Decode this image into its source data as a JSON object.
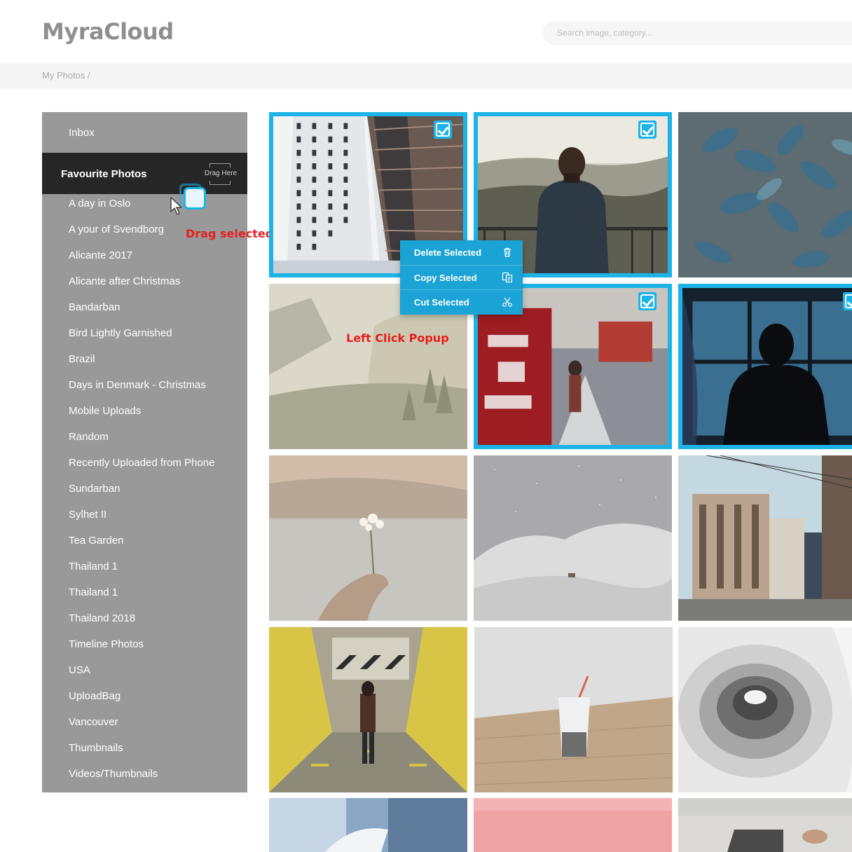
{
  "app": {
    "logo": "MyraCloud"
  },
  "search": {
    "placeholder": "Search image, category..."
  },
  "breadcrumb": "My Photos /",
  "sidebar": {
    "inbox": "Inbox",
    "active": "Favourite Photos",
    "drop_zone": "Drag Here",
    "albums": [
      "A day in Oslo",
      "A your of Svendborg",
      "Alicante 2017",
      "Alicante after Christmas",
      "Bandarban",
      "Bird Lightly Garnished",
      "Brazil",
      "Days in Denmark - Christmas",
      "Mobile Uploads",
      "Random",
      "Recently Uploaded from Phone",
      "Sundarban",
      "Sylhet II",
      "Tea Garden",
      "Thailand 1",
      "Thailand 1",
      "Thailand 2018",
      "Timeline Photos",
      "USA",
      "UploadBag",
      "Vancouver",
      "Thumbnails",
      "Videos/Thumbnails"
    ]
  },
  "annotations": {
    "drag": "Drag selected Image",
    "popup": "Left Click Popup"
  },
  "context_menu": [
    {
      "label": "Delete Selected",
      "icon": "trash-icon"
    },
    {
      "label": "Copy Selected",
      "icon": "copy-icon"
    },
    {
      "label": "Cut Selected",
      "icon": "scissors-icon"
    }
  ],
  "photos": [
    {
      "subject": "skyscrapers",
      "selected": true
    },
    {
      "subject": "man-overlooking-hills",
      "selected": true
    },
    {
      "subject": "blue-leaves",
      "selected": false
    },
    {
      "subject": "misty-valley",
      "selected": false
    },
    {
      "subject": "city-street-red-box",
      "selected": true
    },
    {
      "subject": "man-at-window",
      "selected": true
    },
    {
      "subject": "hand-holding-flower",
      "selected": false
    },
    {
      "subject": "snowy-mountain-night",
      "selected": false
    },
    {
      "subject": "city-buildings",
      "selected": false
    },
    {
      "subject": "yellow-alley-person",
      "selected": false
    },
    {
      "subject": "drink-on-table",
      "selected": false
    },
    {
      "subject": "spiral-staircase",
      "selected": false
    },
    {
      "subject": "waterfall",
      "selected": false
    },
    {
      "subject": "pink-wall",
      "selected": false
    },
    {
      "subject": "laptop-desk",
      "selected": false
    }
  ],
  "colors": {
    "accent": "#1cb4e6",
    "menu": "#1aa3d4",
    "sidebar": "#999999",
    "sidebar_active": "#262626",
    "annotation": "#e61e1e"
  }
}
